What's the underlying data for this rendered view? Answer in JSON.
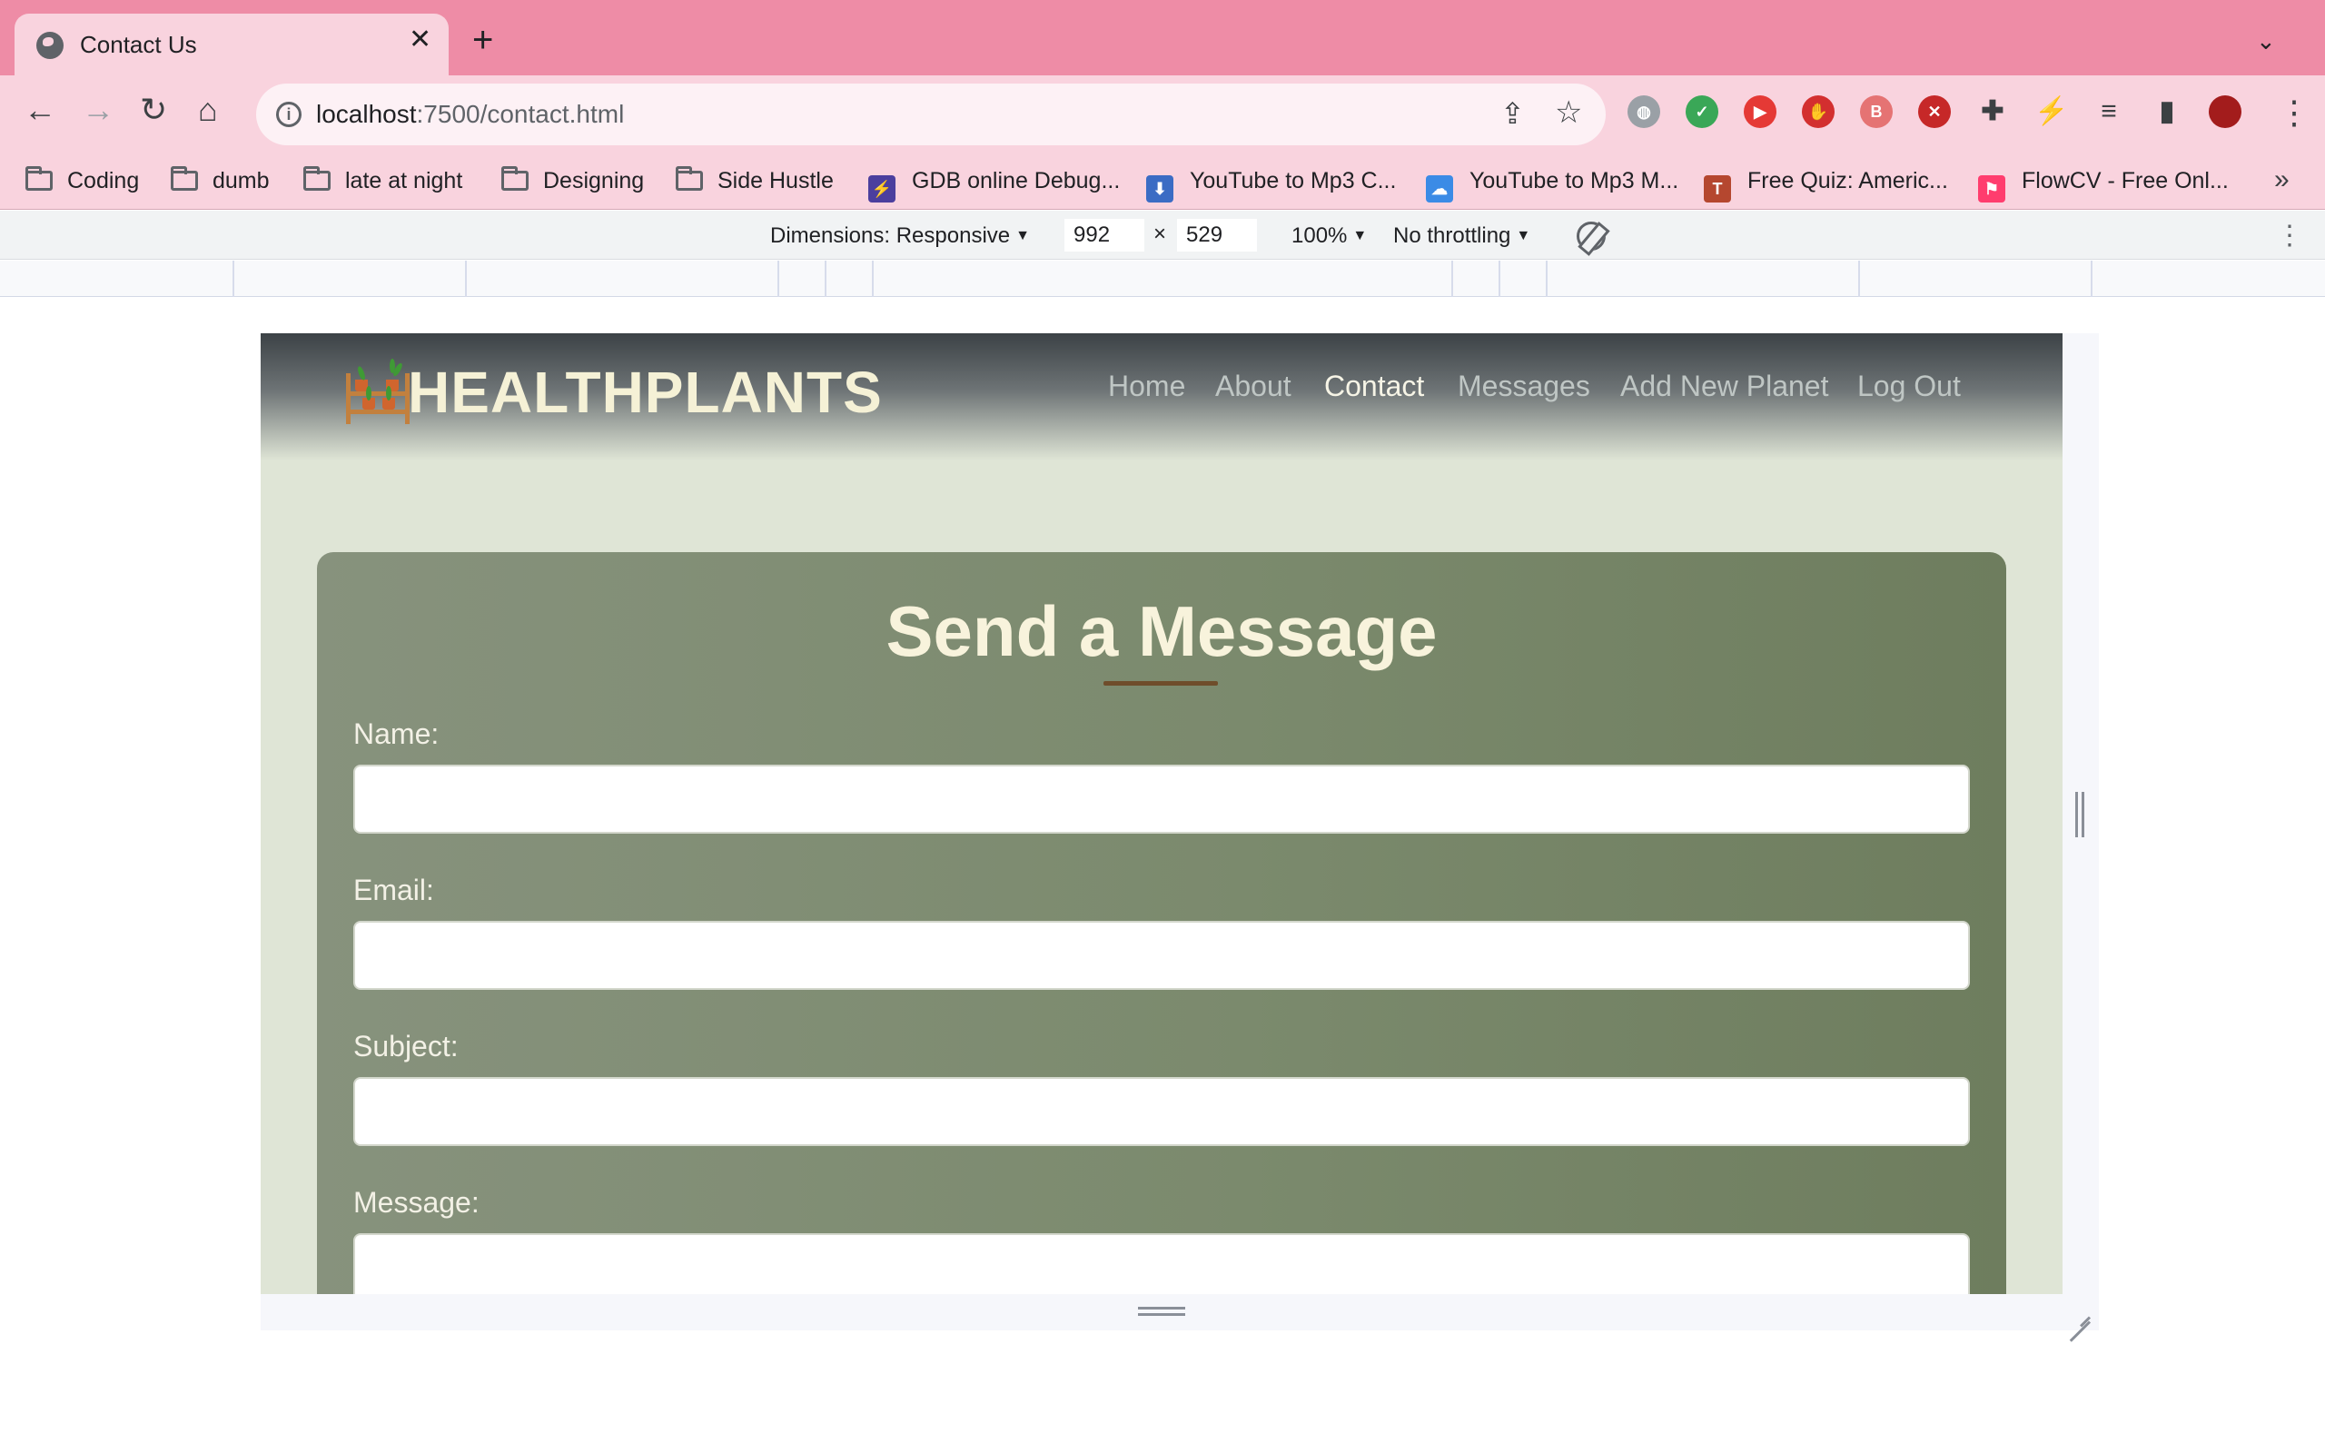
{
  "browser": {
    "tab_title": "Contact Us",
    "url_host": "localhost",
    "url_rest": ":7500/contact.html",
    "bookmarks": [
      {
        "label": "Coding",
        "kind": "folder"
      },
      {
        "label": "dumb",
        "kind": "folder"
      },
      {
        "label": "late at night",
        "kind": "folder"
      },
      {
        "label": "Designing",
        "kind": "folder"
      },
      {
        "label": "Side Hustle",
        "kind": "folder"
      },
      {
        "label": "GDB online Debug...",
        "kind": "site",
        "icon": "bolt-icon",
        "color": "#4b3f9e"
      },
      {
        "label": "YouTube to Mp3 C...",
        "kind": "site",
        "icon": "download-icon",
        "color": "#3b6cc4"
      },
      {
        "label": "YouTube to Mp3 M...",
        "kind": "site",
        "icon": "cloud-download-icon",
        "color": "#3b8be6"
      },
      {
        "label": "Free Quiz: Americ...",
        "kind": "site",
        "icon": "tyl-icon",
        "color": "#b5472f"
      },
      {
        "label": "FlowCV - Free Onl...",
        "kind": "site",
        "icon": "flowcv-icon",
        "color": "#ff3d6e"
      }
    ],
    "extensions": [
      {
        "name": "globe-extension-icon",
        "color": "#9aa0a6"
      },
      {
        "name": "shield-extension-icon",
        "color": "#3aa757"
      },
      {
        "name": "play-extension-icon",
        "color": "#e53935"
      },
      {
        "name": "hand-stop-extension-icon",
        "color": "#d32f2f"
      },
      {
        "name": "badge-extension-icon",
        "color": "#e57373"
      },
      {
        "name": "block-extension-icon",
        "color": "#c62828"
      },
      {
        "name": "puzzle-extensions-icon",
        "color": "#3c4043"
      },
      {
        "name": "leaf-extension-icon",
        "color": "#3c4043"
      },
      {
        "name": "media-queue-icon",
        "color": "#3c4043"
      },
      {
        "name": "side-panel-icon",
        "color": "#3c4043"
      },
      {
        "name": "profile-avatar",
        "color": "#a31c1c"
      }
    ]
  },
  "devtools": {
    "dimensions_label": "Dimensions: Responsive",
    "width_value": "992",
    "times": "×",
    "height_value": "529",
    "zoom": "100%",
    "throttling": "No throttling"
  },
  "site": {
    "logo_text": "HEALTHPLANTS",
    "nav": [
      {
        "label": "Home",
        "active": false
      },
      {
        "label": "About",
        "active": false
      },
      {
        "label": "Contact",
        "active": true
      },
      {
        "label": "Messages",
        "active": false
      },
      {
        "label": "Add New Planet",
        "active": false
      },
      {
        "label": "Log Out",
        "active": false
      }
    ],
    "form": {
      "title": "Send a Message",
      "fields": [
        {
          "label": "Name:",
          "value": ""
        },
        {
          "label": "Email:",
          "value": ""
        },
        {
          "label": "Subject:",
          "value": ""
        },
        {
          "label": "Message:",
          "value": ""
        }
      ]
    }
  },
  "colors": {
    "browser_frame": "#ee8ca6",
    "toolbar": "#f9d3de",
    "page_bg": "#dfe5d6",
    "card": "#7b8a6d",
    "title_text": "#f8f3dc",
    "underline": "#6f4d2b"
  }
}
